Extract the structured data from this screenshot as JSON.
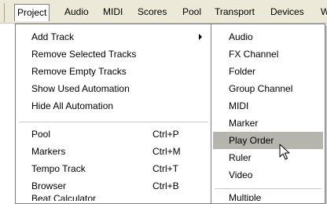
{
  "menubar": {
    "items": [
      {
        "label": "Project"
      },
      {
        "label": "Audio"
      },
      {
        "label": "MIDI"
      },
      {
        "label": "Scores"
      },
      {
        "label": "Pool"
      },
      {
        "label": "Transport"
      },
      {
        "label": "Devices"
      },
      {
        "label": "W"
      }
    ]
  },
  "project_menu": {
    "items": [
      {
        "label": "Add Track",
        "shortcut": "",
        "has_submenu": true
      },
      {
        "label": "Remove Selected Tracks",
        "shortcut": ""
      },
      {
        "label": "Remove Empty Tracks",
        "shortcut": ""
      },
      {
        "label": "Show Used Automation",
        "shortcut": ""
      },
      {
        "label": "Hide All Automation",
        "shortcut": ""
      },
      {
        "label": "Pool",
        "shortcut": "Ctrl+P"
      },
      {
        "label": "Markers",
        "shortcut": "Ctrl+M"
      },
      {
        "label": "Tempo Track",
        "shortcut": "Ctrl+T"
      },
      {
        "label": "Browser",
        "shortcut": "Ctrl+B"
      },
      {
        "label": "Beat Calculator",
        "shortcut": ""
      }
    ]
  },
  "add_track_submenu": {
    "items": [
      {
        "label": "Audio"
      },
      {
        "label": "FX Channel"
      },
      {
        "label": "Folder"
      },
      {
        "label": "Group Channel"
      },
      {
        "label": "MIDI"
      },
      {
        "label": "Marker"
      },
      {
        "label": "Play Order"
      },
      {
        "label": "Ruler"
      },
      {
        "label": "Video"
      },
      {
        "label": "Multiple"
      }
    ],
    "highlighted": "Play Order"
  },
  "cursor": {
    "icon": "mouse-pointer-icon"
  },
  "colors": {
    "menubar_bg": "#ece9d8",
    "highlight": "#b5b5ae",
    "menu_bg": "#ffffff"
  }
}
